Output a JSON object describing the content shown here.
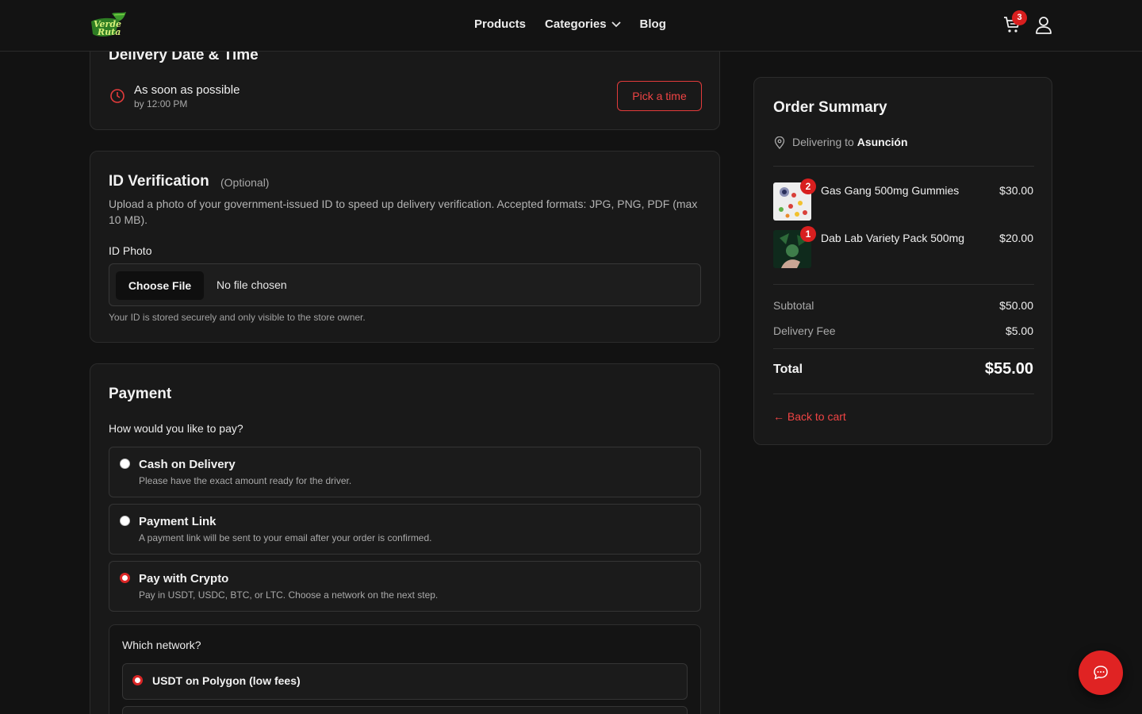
{
  "header": {
    "logo_alt": "Verde Ruta",
    "nav": [
      {
        "label": "Products"
      },
      {
        "label": "Categories"
      },
      {
        "label": "Blog"
      }
    ],
    "cart_count": "3",
    "icons": {
      "cart": "cart-icon",
      "user": "user-icon",
      "chevron": "chevron-down-icon"
    }
  },
  "delivery": {
    "title": "Delivery Date & Time",
    "asap": "As soon as possible",
    "by_time": "by 12:00 PM",
    "pick_button": "Pick a time"
  },
  "id_verification": {
    "title": "ID Verification",
    "optional": "(Optional)",
    "description": "Upload a photo of your government-issued ID to speed up delivery verification. Accepted formats: JPG, PNG, PDF (max 10 MB).",
    "field_label": "ID Photo",
    "choose_button": "Choose File",
    "no_file": "No file chosen",
    "note": "Your ID is stored securely and only visible to the store owner."
  },
  "payment": {
    "title": "Payment",
    "question": "How would you like to pay?",
    "options": [
      {
        "title": "Cash on Delivery",
        "desc": "Please have the exact amount ready for the driver.",
        "selected": false
      },
      {
        "title": "Payment Link",
        "desc": "A payment link will be sent to your email after your order is confirmed.",
        "selected": false
      },
      {
        "title": "Pay with Crypto",
        "desc": "Pay in USDT, USDC, BTC, or LTC. Choose a network on the next step.",
        "selected": true
      }
    ],
    "network": {
      "question": "Which network?",
      "options": [
        {
          "title": "USDT on Polygon (low fees)",
          "selected": true
        }
      ]
    }
  },
  "summary": {
    "title": "Order Summary",
    "delivering_prefix": "Delivering to",
    "city": "Asunción",
    "items": [
      {
        "qty": "2",
        "name": "Gas Gang 500mg Gummies",
        "price": "$30.00"
      },
      {
        "qty": "1",
        "name": "Dab Lab Variety Pack 500mg",
        "price": "$20.00"
      }
    ],
    "subtotal_label": "Subtotal",
    "subtotal": "$50.00",
    "fee_label": "Delivery Fee",
    "fee": "$5.00",
    "total_label": "Total",
    "total": "$55.00",
    "back_link": "← Back to cart"
  },
  "colors": {
    "accent": "#e02323",
    "background": "#121212",
    "card": "#191919"
  }
}
